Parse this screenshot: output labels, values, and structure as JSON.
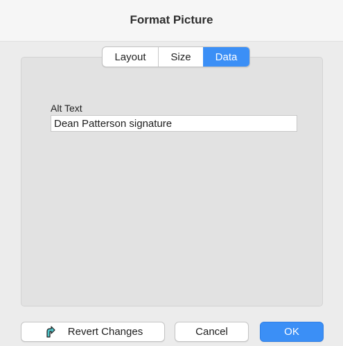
{
  "window": {
    "title": "Format Picture"
  },
  "tabs": {
    "items": [
      {
        "label": "Layout"
      },
      {
        "label": "Size"
      },
      {
        "label": "Data"
      }
    ],
    "selected": "Data"
  },
  "data_tab": {
    "alt_text_label": "Alt Text",
    "alt_text_value": "Dean Patterson signature"
  },
  "buttons": {
    "revert_label": "Revert Changes",
    "revert_icon": "revert-arrow-icon",
    "cancel_label": "Cancel",
    "ok_label": "OK"
  },
  "colors": {
    "accent": "#3b8ff6",
    "revert_icon_fill": "#4ec2c7"
  }
}
